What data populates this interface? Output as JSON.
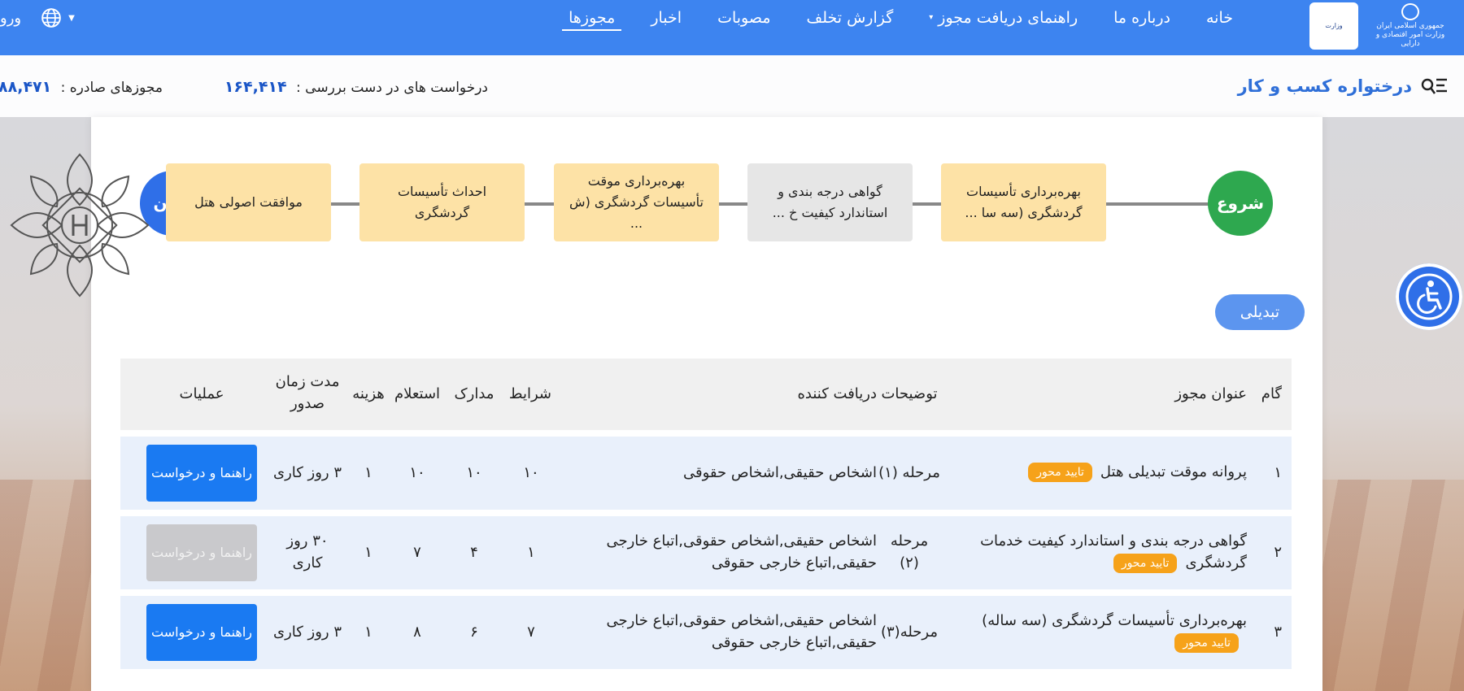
{
  "nav": {
    "menu": [
      {
        "label": "خانه",
        "active": false,
        "has_dropdown": false
      },
      {
        "label": "درباره ما",
        "active": false,
        "has_dropdown": false
      },
      {
        "label": "راهنمای دریافت مجوز",
        "active": false,
        "has_dropdown": true
      },
      {
        "label": "گزارش تخلف",
        "active": false,
        "has_dropdown": false
      },
      {
        "label": "مصوبات",
        "active": false,
        "has_dropdown": false
      },
      {
        "label": "اخبار",
        "active": false,
        "has_dropdown": false
      },
      {
        "label": "مجوزها",
        "active": true,
        "has_dropdown": false
      }
    ],
    "login_label": "ورود",
    "logo_a_lines": [
      "جمهوری اسلامی ایران",
      "وزارت امور اقتصادی و دارایی"
    ],
    "logo_b_text": "وزارت"
  },
  "stats": {
    "brand_title": "درختواره کسب و کار",
    "in_review_label": "درخواست های در دست بررسی :",
    "in_review_value": "۱۶۴,۴۱۴",
    "issued_label": "مجوزهای صادره :",
    "issued_value": "۸۸,۴۷۱"
  },
  "flow": {
    "start": "شروع",
    "end": "پایان",
    "steps": [
      {
        "label": "موافقت اصولی هتل",
        "state": "done"
      },
      {
        "label": "احداث تأسیسات گردشگری",
        "state": "done"
      },
      {
        "label": "بهره‌برداری موقت تأسیسات گردشگری (ش ...",
        "state": "done"
      },
      {
        "label": "گواهی درجه بندی و استاندارد کیفیت خ ...",
        "state": "pending"
      },
      {
        "label": "بهره‌برداری تأسیسات گردشگری (سه سا ...",
        "state": "done"
      }
    ]
  },
  "tab_label": "تبدیلی",
  "table": {
    "headers": {
      "step": "گام",
      "title": "عنوان مجوز",
      "desc": "توضیحات",
      "receiver": "دریافت کننده",
      "conditions": "شرایط",
      "docs": "مدارک",
      "inquiry": "استعلام",
      "fee": "هزینه",
      "time": "مدت زمان صدور",
      "ops": "عملیات"
    },
    "rows": [
      {
        "step": "۱",
        "title": "پروانه موقت تبدیلی هتل",
        "badge": "تایید محور",
        "desc": "مرحله (۱)",
        "receiver": "اشخاص حقیقی,اشخاص حقوقی",
        "conditions": "۱۰",
        "docs": "۱۰",
        "inquiry": "۱۰",
        "fee": "۱",
        "time": "۳ روز کاری",
        "button": "راهنما و درخواست",
        "button_enabled": true
      },
      {
        "step": "۲",
        "title": "گواهی درجه بندی و استاندارد کیفیت خدمات گردشگری",
        "badge": "تایید محور",
        "desc": "مرحله (۲)",
        "receiver": "اشخاص حقیقی,اشخاص حقوقی,اتباع خارجی حقیقی,اتباع خارجی حقوقی",
        "conditions": "۱",
        "docs": "۴",
        "inquiry": "۷",
        "fee": "۱",
        "time": "۳۰ روز کاری",
        "button": "راهنما و درخواست",
        "button_enabled": false
      },
      {
        "step": "۳",
        "title": "بهره‌برداری تأسیسات گردشگری (سه ساله)",
        "badge": "تایید محور",
        "desc": "مرحله(۳)",
        "receiver": "اشخاص حقیقی,اشخاص حقوقی,اتباع خارجی حقیقی,اتباع خارجی حقوقی",
        "conditions": "۷",
        "docs": "۶",
        "inquiry": "۸",
        "fee": "۱",
        "time": "۳ روز کاری",
        "button": "راهنما و درخواست",
        "button_enabled": true
      }
    ]
  },
  "colors": {
    "nav": "#3d84f0",
    "accent": "#1b56c7",
    "start_node": "#2ea84f",
    "end_node": "#2f6fe8",
    "done_step": "#fde2a6",
    "pending_step": "#e6e6e6",
    "badge": "#f6a21a",
    "button": "#1a7af2",
    "button_disabled": "#c9c9cc",
    "row_bg": "#e9f0fb"
  },
  "icons": {
    "globe": "globe-icon",
    "search": "search-list-icon",
    "accessibility": "wheelchair-icon",
    "ornament": "ornament-emblem-icon"
  }
}
